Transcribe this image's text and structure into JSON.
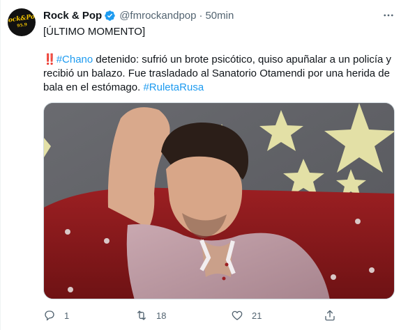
{
  "tweet": {
    "author": {
      "display_name": "Rock & Pop",
      "handle": "@fmrockandpop",
      "verified": true,
      "avatar_text": "Rock&Pop",
      "avatar_sub": "95.9"
    },
    "separator": "·",
    "time": "50min",
    "text": {
      "headline": "[ÚLTIMO MOMENTO]",
      "alarm": "‼️",
      "hashtag_1": "#Chano",
      "body": " detenido: sufrió un brote psicótico, quiso apuñalar a un policía y recibió un balazo. Fue trasladado al Sanatorio Otamendi por una herida de bala en el estómago. ",
      "hashtag_2": "#RuletaRusa"
    },
    "actions": {
      "reply_count": "1",
      "retweet_count": "18",
      "like_count": "21",
      "share_count": ""
    }
  },
  "colors": {
    "link": "#1d9bf0",
    "secondary_text": "#536471",
    "verified": "#1d9bf0"
  },
  "icons": {
    "more": "more-dots-icon",
    "reply": "reply-icon",
    "retweet": "retweet-icon",
    "like": "heart-icon",
    "share": "share-icon"
  }
}
